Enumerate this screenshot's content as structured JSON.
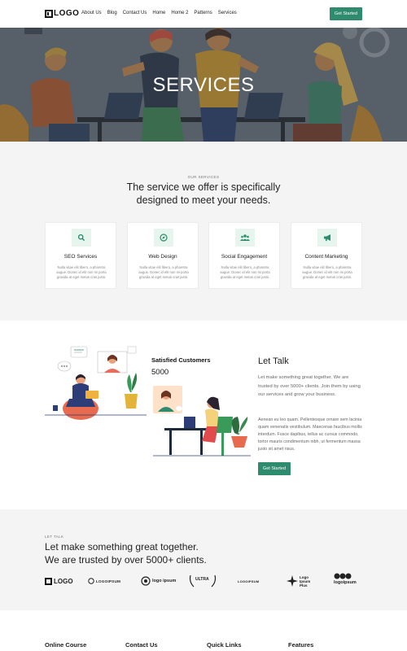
{
  "header": {
    "logo_text": "LOGO",
    "nav": [
      "About Us",
      "Blog",
      "Contact Us",
      "Home",
      "Home 2",
      "Patterns",
      "Services"
    ],
    "cta_label": "Get Started"
  },
  "hero": {
    "title": "SERVICES"
  },
  "services": {
    "eyebrow": "OUR SERVICES",
    "title_line1": "The service we offer is specifically",
    "title_line2": "designed to meet your needs.",
    "cards": [
      {
        "title": "SEO Services",
        "icon": "search-icon",
        "desc": "Nulla vitae elit libero, a pharetra augue. Donec id elit non mi porta gravida at eget metus cras justo."
      },
      {
        "title": "Web Design",
        "icon": "compass-icon",
        "desc": "Nulla vitae elit libero, a pharetra augue. Donec id elit non mi porta gravida at eget metus cras justo."
      },
      {
        "title": "Social Engagement",
        "icon": "users-icon",
        "desc": "Nulla vitae elit libero, a pharetra augue. Donec id elit non mi porta gravida at eget metus cras justo."
      },
      {
        "title": "Content Marketing",
        "icon": "megaphone-icon",
        "desc": "Nulla vitae elit libero, a pharetra augue. Donec id elit non mi porta gravida at eget metus cras justo."
      }
    ]
  },
  "talk": {
    "satisfied_title": "Satisfied Customers",
    "satisfied_count": "5000",
    "title": "Let Talk",
    "para1": "Let make something great together. We are trusted by over 5000+ clients. Join them by using our services and grow your business.",
    "para2": "Aenean eu leo quam. Pellentesque ornare sem lacinia quam venenatis vestibulum. Maecenas faucibus mollis interdum. Fusce dapibus, tellus ac cursus commodo, tortor mauris condimentum nibh, ut fermentum massa justo sit amet risus.",
    "cta_label": "Get Started"
  },
  "brands": {
    "eyebrow": "LET TALK",
    "title_line1": "Let make something great together.",
    "title_line2": "We are trusted by over 5000+ clients.",
    "logos": [
      "LOGO",
      "LOGOIPSUM",
      "logo ipsum",
      "ULTRA",
      "LOGOIPSUM",
      "Logo Ipsum Plus",
      "logoipsum"
    ]
  },
  "footer": {
    "headings": [
      "Online Course",
      "Contact Us",
      "Quick Links",
      "Features"
    ]
  },
  "colors": {
    "accent": "#2e8b6e",
    "icon_bg": "#e6f5ee",
    "section_bg": "#f4f4f4"
  }
}
